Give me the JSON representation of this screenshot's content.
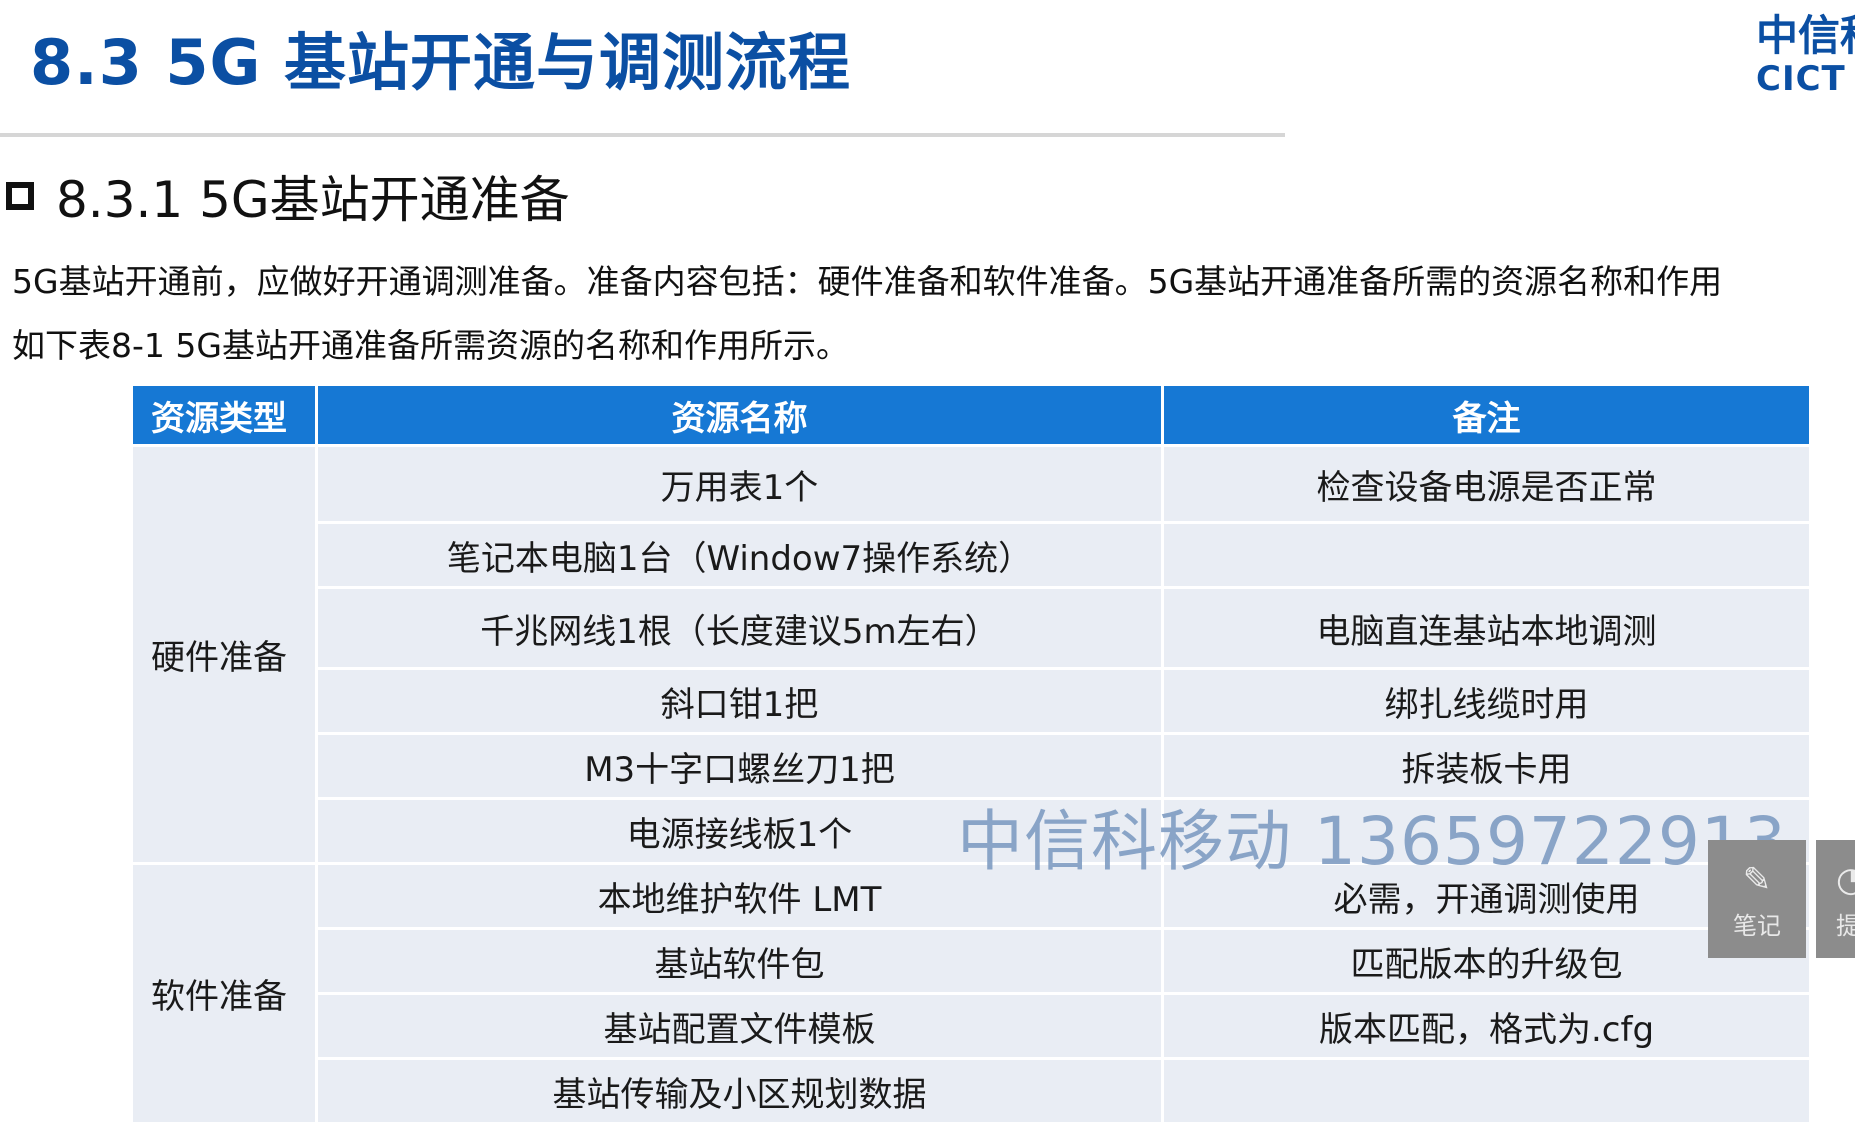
{
  "slide": {
    "title": "8.3 5G 基站开通与调测流程",
    "logo_cn": "中信科",
    "logo_en": "CICT M"
  },
  "section": {
    "heading": "8.3.1 5G基站开通准备",
    "intro_line1": "5G基站开通前，应做好开通调测准备。准备内容包括：硬件准备和软件准备。5G基站开通准备所需的资源名称和作用",
    "intro_line2": "如下表8-1  5G基站开通准备所需资源的名称和作用所示。"
  },
  "table": {
    "headers": [
      "资源类型",
      "资源名称",
      "备注"
    ],
    "groups": [
      {
        "type": "硬件准备",
        "rows": [
          {
            "name": "万用表1个",
            "note": "检查设备电源是否正常"
          },
          {
            "name": "笔记本电脑1台（Window7操作系统）",
            "note": ""
          },
          {
            "name": "千兆网线1根（长度建议5m左右）",
            "note": "电脑直连基站本地调测"
          },
          {
            "name": "斜口钳1把",
            "note": "绑扎线缆时用"
          },
          {
            "name": "M3十字口螺丝刀1把",
            "note": "拆装板卡用"
          },
          {
            "name": "电源接线板1个",
            "note": ""
          }
        ]
      },
      {
        "type": "软件准备",
        "rows": [
          {
            "name": "本地维护软件 LMT",
            "note": "必需，开通调测使用"
          },
          {
            "name": "基站软件包",
            "note": "匹配版本的升级包"
          },
          {
            "name": "基站配置文件模板",
            "note": "版本匹配，格式为.cfg"
          },
          {
            "name": "基站传输及小区规划数据",
            "note": ""
          }
        ]
      }
    ]
  },
  "watermark": "中信科移动 13659722913",
  "side_buttons": {
    "note_label": "笔记",
    "note_icon": "pencil-icon",
    "ask_label": "提",
    "ask_icon": "question-icon"
  }
}
